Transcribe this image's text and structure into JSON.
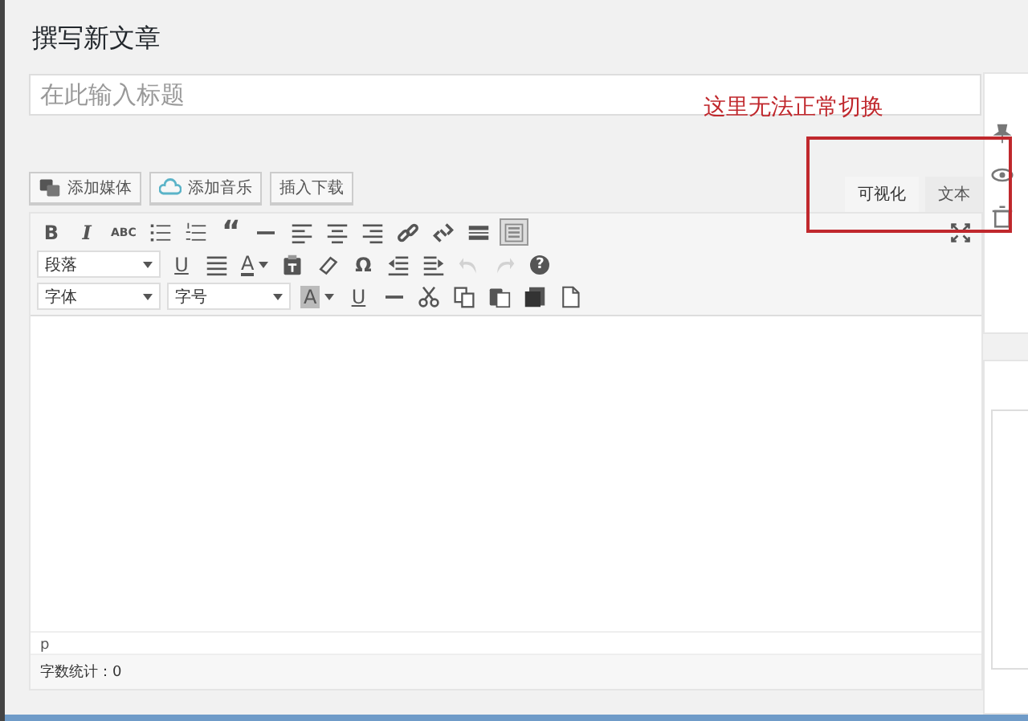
{
  "page_title": "撰写新文章",
  "title_field": {
    "placeholder": "在此输入标题"
  },
  "media_buttons": [
    {
      "kind": "media",
      "label": "添加媒体"
    },
    {
      "kind": "music",
      "label": "添加音乐"
    },
    {
      "kind": "plain",
      "label": "插入下载"
    }
  ],
  "editor_tabs": [
    {
      "label": "可视化",
      "selected": true
    },
    {
      "label": "文本",
      "selected": false
    }
  ],
  "toolbar_rows": [
    [
      {
        "kind": "bold",
        "label": "B"
      },
      {
        "kind": "italic",
        "label": "I"
      },
      {
        "kind": "strike",
        "label": "ABC"
      },
      {
        "kind": "bullets"
      },
      {
        "kind": "numbers"
      },
      {
        "kind": "quote",
        "label": "“"
      },
      {
        "kind": "rule"
      },
      {
        "kind": "alignleft"
      },
      {
        "kind": "aligncenter"
      },
      {
        "kind": "alignright"
      },
      {
        "kind": "link"
      },
      {
        "kind": "unlink"
      },
      {
        "kind": "more"
      },
      {
        "kind": "toggle",
        "pressed": true
      }
    ],
    [
      {
        "kind": "select",
        "label": "段落"
      },
      {
        "kind": "underline",
        "label": "U"
      },
      {
        "kind": "justify"
      },
      {
        "kind": "color",
        "label": "A"
      },
      {
        "kind": "pastetext"
      },
      {
        "kind": "eraser"
      },
      {
        "kind": "symbol",
        "label": "Ω"
      },
      {
        "kind": "outdent"
      },
      {
        "kind": "indent"
      },
      {
        "kind": "undo",
        "disabled": true
      },
      {
        "kind": "redo",
        "disabled": true
      },
      {
        "kind": "help",
        "label": "?"
      }
    ],
    [
      {
        "kind": "select",
        "label": "字体"
      },
      {
        "kind": "select",
        "label": "字号"
      },
      {
        "kind": "bgcolor",
        "label": "A"
      },
      {
        "kind": "underline",
        "label": "U"
      },
      {
        "kind": "rule"
      },
      {
        "kind": "cut"
      },
      {
        "kind": "copy"
      },
      {
        "kind": "paste"
      },
      {
        "kind": "pasteword"
      },
      {
        "kind": "newdoc"
      }
    ]
  ],
  "status_bar": {
    "path": "p",
    "word_count": "字数统计：0"
  },
  "annotation": {
    "text": "这里无法正常切换"
  }
}
